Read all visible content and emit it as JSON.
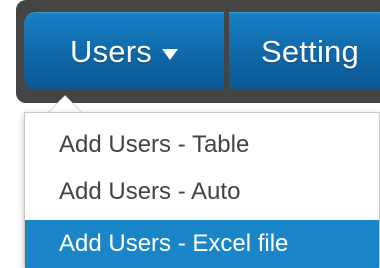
{
  "navbar": {
    "tabs": [
      {
        "label": "Users",
        "has_dropdown": true
      },
      {
        "label": "Setting"
      }
    ]
  },
  "dropdown": {
    "items": [
      {
        "label": "Add Users - Table"
      },
      {
        "label": "Add Users - Auto"
      },
      {
        "label": "Add Users - Excel file",
        "highlighted": true
      }
    ]
  },
  "colors": {
    "navbar_bg": "#444444",
    "tab_blue": "#0f68a8",
    "highlight": "#1a86c8"
  }
}
